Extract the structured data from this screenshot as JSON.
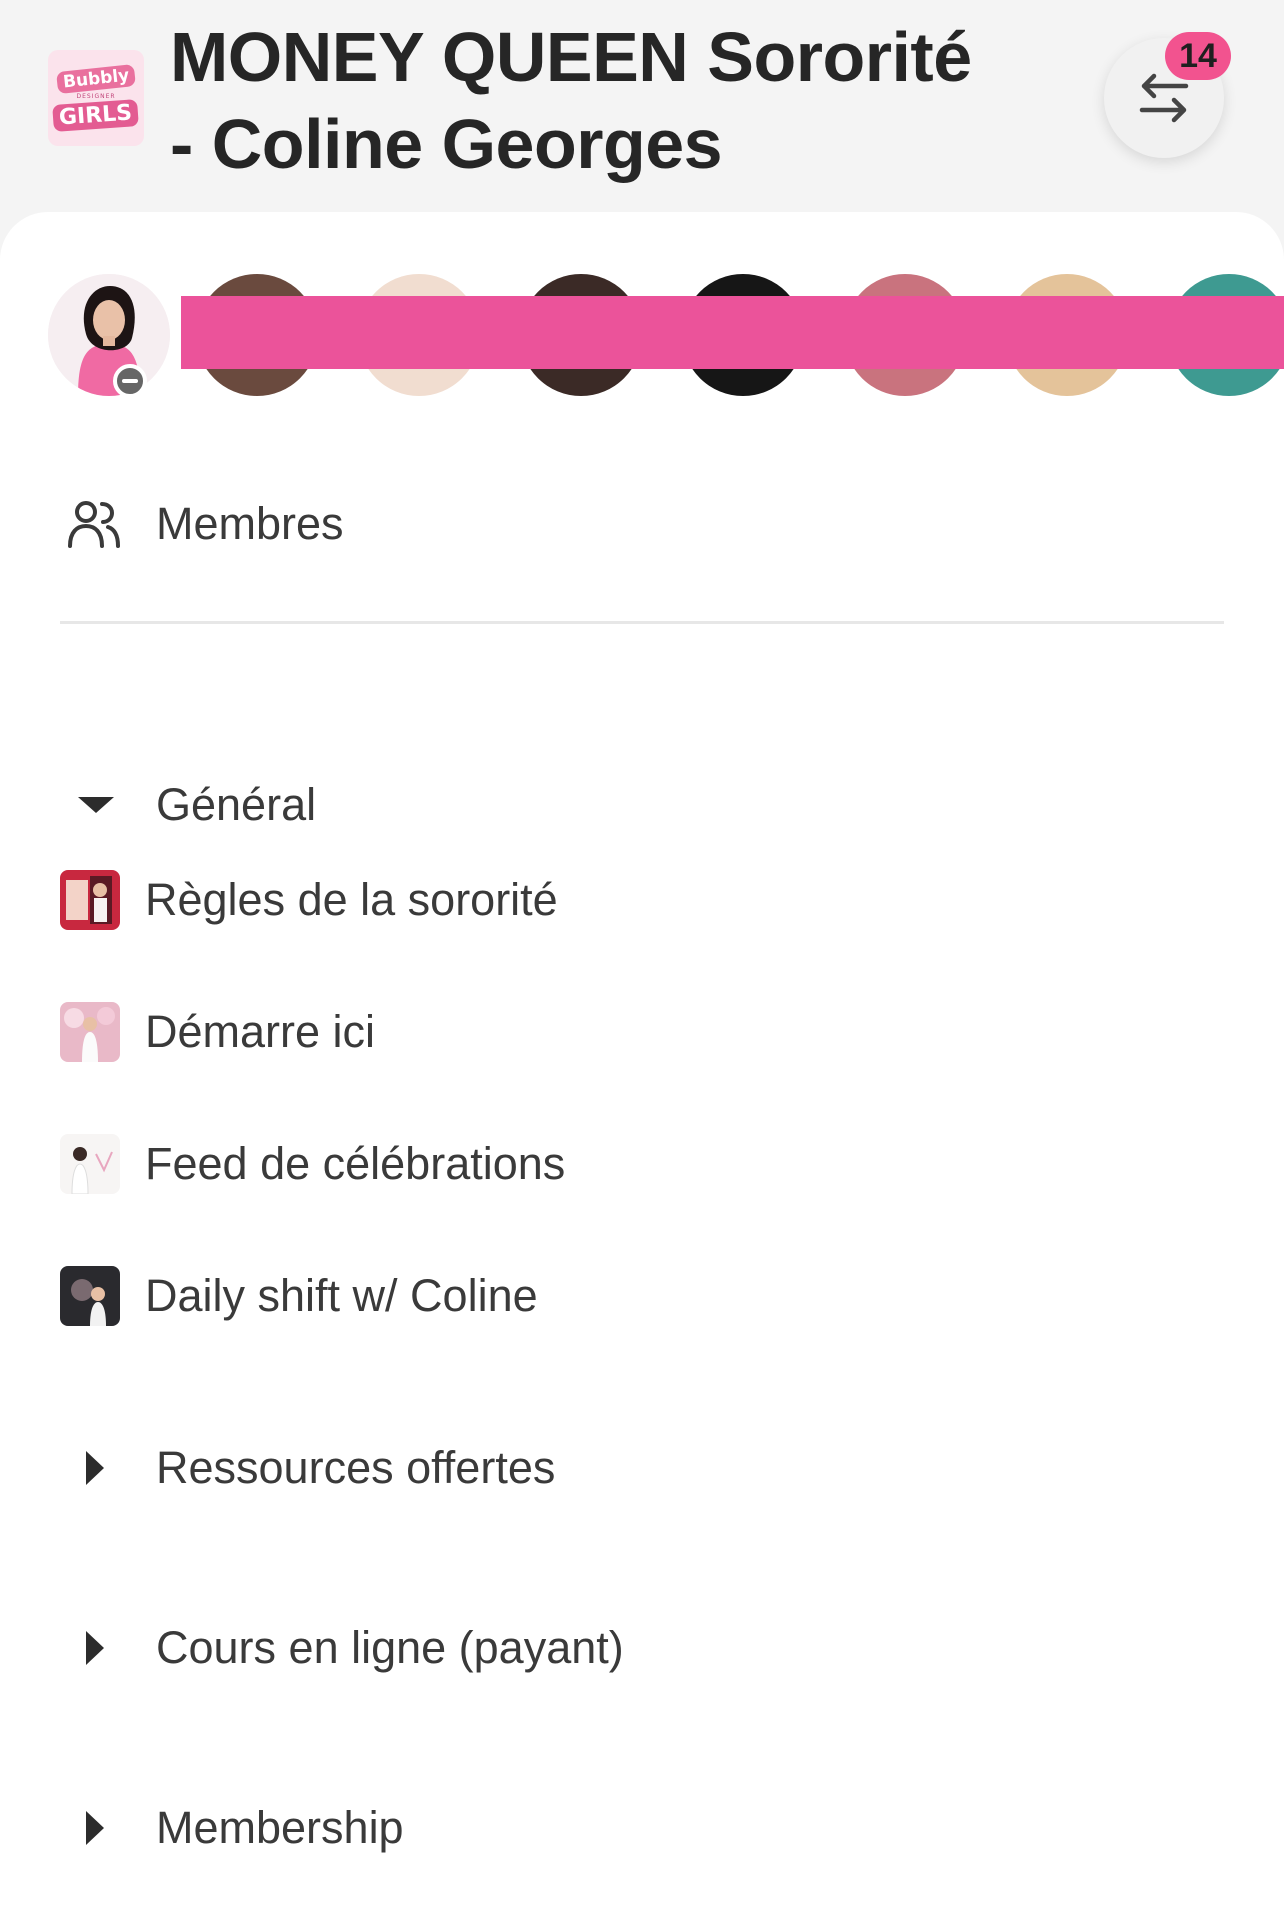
{
  "header": {
    "logo_top": "Bubbly",
    "logo_mid": "DESIGNER",
    "logo_bottom": "GIRLS",
    "title_line1": "MONEY QUEEN Sororité",
    "title_line2": "- Coline Georges",
    "switch_icon": "swap-arrows-icon",
    "badge_count": "14"
  },
  "members": {
    "icon": "members-icon",
    "label": "Membres"
  },
  "sections": [
    {
      "label": "Général",
      "expanded": true
    },
    {
      "label": "Ressources offertes",
      "expanded": false
    },
    {
      "label": "Cours en ligne (payant)",
      "expanded": false
    },
    {
      "label": "Membership",
      "expanded": false
    }
  ],
  "channels": [
    {
      "label": "Règles de la sororité"
    },
    {
      "label": "Démarre ici"
    },
    {
      "label": "Feed de célébrations"
    },
    {
      "label": "Daily shift w/ Coline"
    }
  ],
  "colors": {
    "accent": "#eb539a",
    "badge": "#f2538f"
  }
}
